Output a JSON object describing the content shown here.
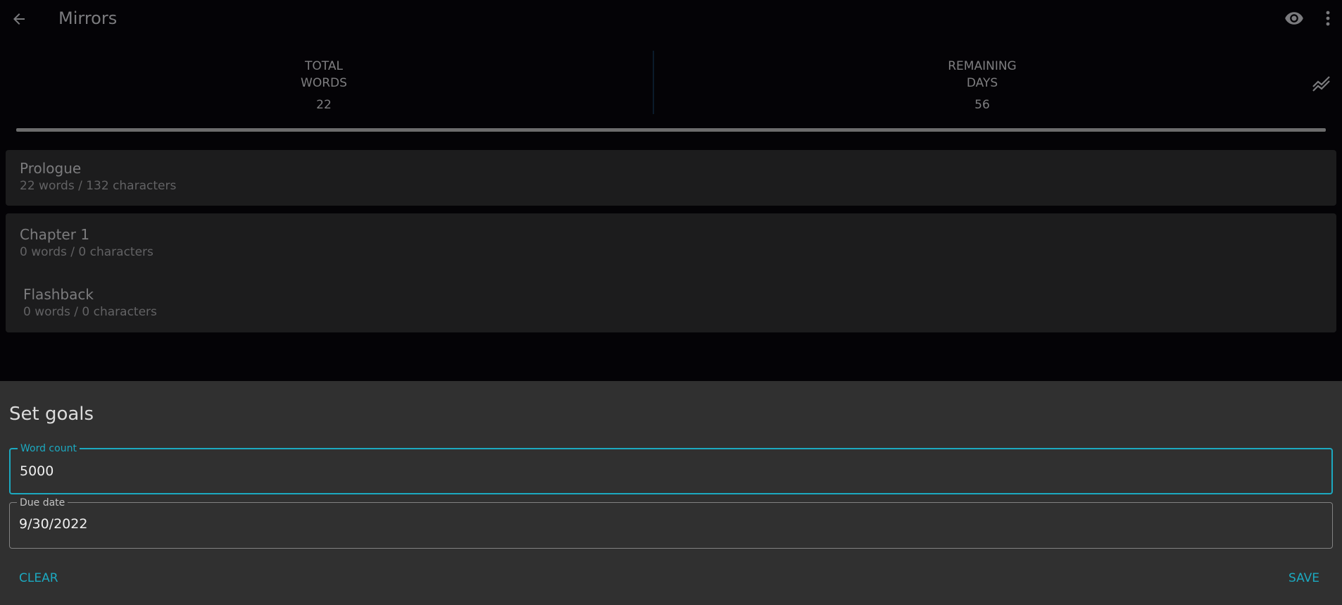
{
  "header": {
    "title": "Mirrors",
    "back_icon": "arrow-left-icon",
    "preview_icon": "eye-icon",
    "menu_icon": "more-vertical-icon"
  },
  "stats": {
    "total_words_label": "TOTAL\nWORDS",
    "total_words_value": "22",
    "remaining_days_label": "REMAINING\nDAYS",
    "remaining_days_value": "56",
    "chart_icon": "trend-chart-icon",
    "progress_fraction": 0.0
  },
  "chapters": [
    {
      "name": "Prologue",
      "meta": "22 words / 132 characters"
    },
    {
      "name": "Chapter 1",
      "meta": "0 words / 0 characters"
    },
    {
      "name": "Flashback",
      "meta": "0 words / 0 characters"
    }
  ],
  "goals_sheet": {
    "title": "Set goals",
    "word_count_label": "Word count",
    "word_count_value": "5000",
    "due_date_label": "Due date",
    "due_date_value": "9/30/2022",
    "clear_label": "CLEAR",
    "save_label": "SAVE"
  },
  "colors": {
    "accent": "#1ca9c0",
    "background": "#040306",
    "sheet": "#303030",
    "card": "#1c1c1d"
  }
}
